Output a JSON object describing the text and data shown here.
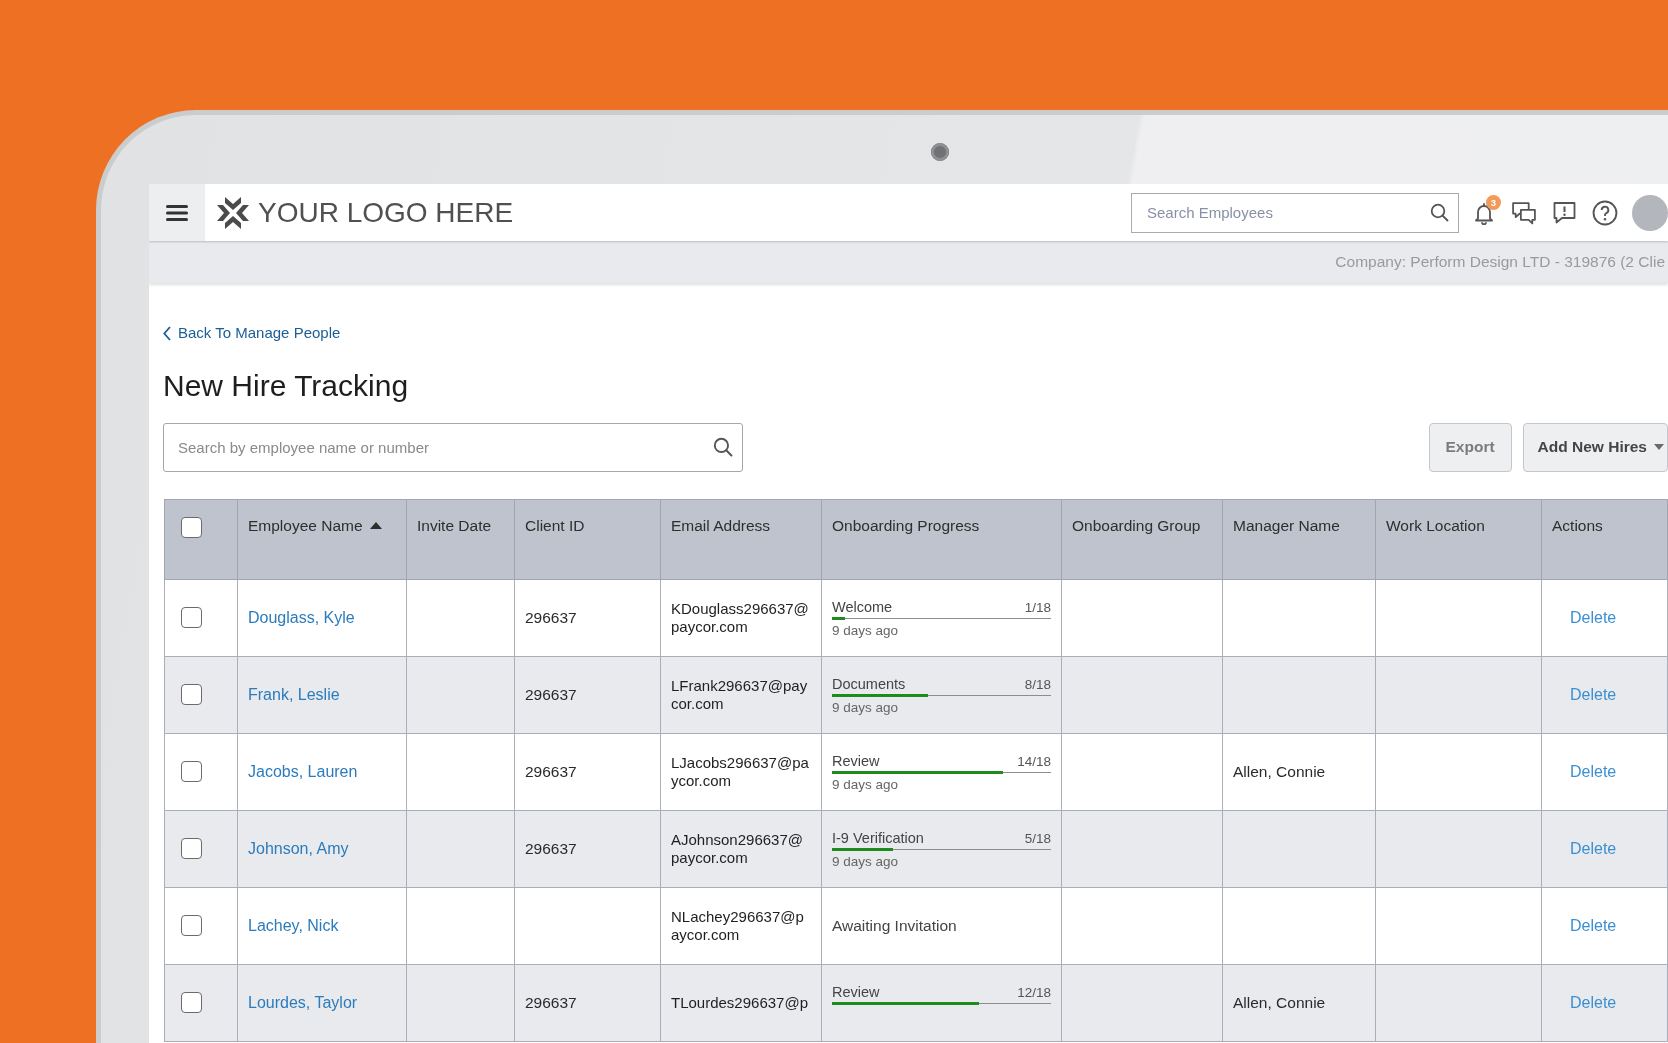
{
  "header": {
    "logo": "YOUR LOGO HERE",
    "search": {
      "placeholder": "Search Employees"
    },
    "notifications": {
      "badge": "3"
    },
    "company": "Company: Perform Design LTD - 319876 (2 Clie"
  },
  "page": {
    "back_link": "Back To Manage People",
    "title": "New Hire Tracking",
    "search": {
      "placeholder": "Search by employee name or number"
    },
    "buttons": [
      {
        "label": "Export",
        "kind": "plain",
        "disabled": true
      },
      {
        "label": "Add New Hires",
        "kind": "dropdown",
        "disabled": false
      }
    ]
  },
  "table": {
    "select_all": {
      "checked": false
    },
    "columns": [
      {
        "label": "Employee Name",
        "sorted_ascending": true
      },
      {
        "label": "Invite Date"
      },
      {
        "label": "Client ID"
      },
      {
        "label": "Email Address"
      },
      {
        "label": "Onboarding Progress"
      },
      {
        "label": "Onboarding Group"
      },
      {
        "label": "Manager Name"
      },
      {
        "label": "Work Location"
      },
      {
        "label": "Actions"
      }
    ],
    "rows": [
      {
        "selected": false,
        "employee_name": "Douglass, Kyle",
        "client_id": "296637",
        "email_address": "KDouglass296637@paycor.com",
        "onboarding_progress": {
          "kind": "step",
          "step": "Welcome",
          "count": "1/18",
          "level": 0.06,
          "age": "9 days ago"
        },
        "actions": "Delete"
      },
      {
        "selected": false,
        "employee_name": "Frank, Leslie",
        "client_id": "296637",
        "email_address": "LFrank296637@paycor.com",
        "onboarding_progress": {
          "kind": "step",
          "step": "Documents",
          "count": "8/18",
          "level": 0.44,
          "age": "9 days ago"
        },
        "actions": "Delete"
      },
      {
        "selected": false,
        "employee_name": "Jacobs, Lauren",
        "client_id": "296637",
        "email_address": "LJacobs296637@paycor.com",
        "onboarding_progress": {
          "kind": "step",
          "step": "Review",
          "count": "14/18",
          "level": 0.78,
          "age": "9 days ago"
        },
        "manager_name": "Allen, Connie",
        "actions": "Delete"
      },
      {
        "selected": false,
        "employee_name": "Johnson, Amy",
        "client_id": "296637",
        "email_address": "AJohnson296637@paycor.com",
        "onboarding_progress": {
          "kind": "step",
          "step": "I-9 Verification",
          "count": "5/18",
          "level": 0.28,
          "age": "9 days ago"
        },
        "actions": "Delete"
      },
      {
        "selected": false,
        "employee_name": "Lachey, Nick",
        "email_address": "NLachey296637@paycor.com",
        "onboarding_progress": {
          "kind": "status",
          "text": "Awaiting Invitation"
        },
        "actions": "Delete"
      },
      {
        "selected": false,
        "employee_name": "Lourdes, Taylor",
        "client_id": "296637",
        "email_address": "TLourdes296637@p",
        "onboarding_progress": {
          "kind": "step",
          "step": "Review",
          "count": "12/18",
          "level": 0.67
        },
        "manager_name": "Allen, Connie",
        "actions": "Delete"
      }
    ]
  }
}
